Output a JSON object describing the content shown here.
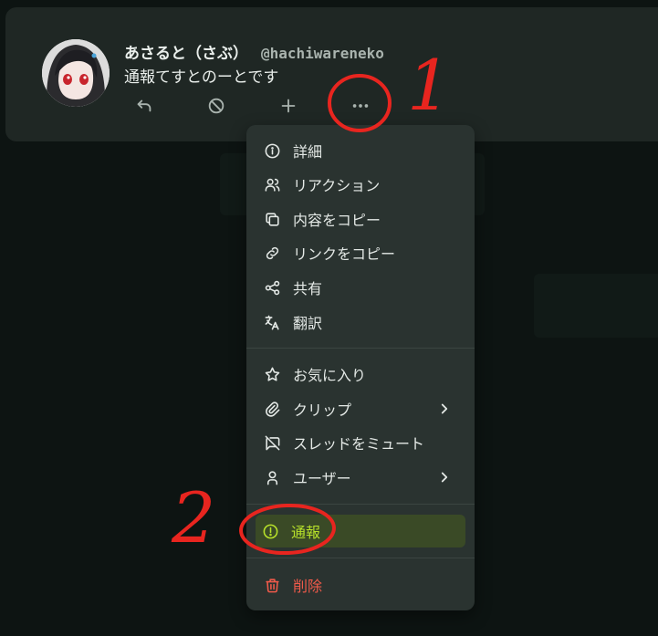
{
  "note": {
    "author_name": "あさると（さぶ）",
    "author_username": "@hachiwareneko",
    "text": "通報てすとのーとです"
  },
  "menu": {
    "items": [
      {
        "label": "詳細",
        "icon": "info-circle-icon"
      },
      {
        "label": "リアクション",
        "icon": "users-icon"
      },
      {
        "label": "内容をコピー",
        "icon": "copy-icon"
      },
      {
        "label": "リンクをコピー",
        "icon": "link-icon"
      },
      {
        "label": "共有",
        "icon": "share-icon"
      },
      {
        "label": "翻訳",
        "icon": "translate-icon"
      },
      {
        "label": "お気に入り",
        "icon": "star-icon"
      },
      {
        "label": "クリップ",
        "icon": "paperclip-icon"
      },
      {
        "label": "スレッドをミュート",
        "icon": "message-off-icon"
      },
      {
        "label": "ユーザー",
        "icon": "user-icon"
      },
      {
        "label": "通報",
        "icon": "exclamation-circle-icon"
      },
      {
        "label": "削除",
        "icon": "trash-icon"
      }
    ]
  },
  "annotations": {
    "one": "1",
    "two": "2"
  },
  "colors": {
    "accent": "#b7e12a",
    "danger": "#ef5a4a",
    "annotation": "#e8251f"
  }
}
